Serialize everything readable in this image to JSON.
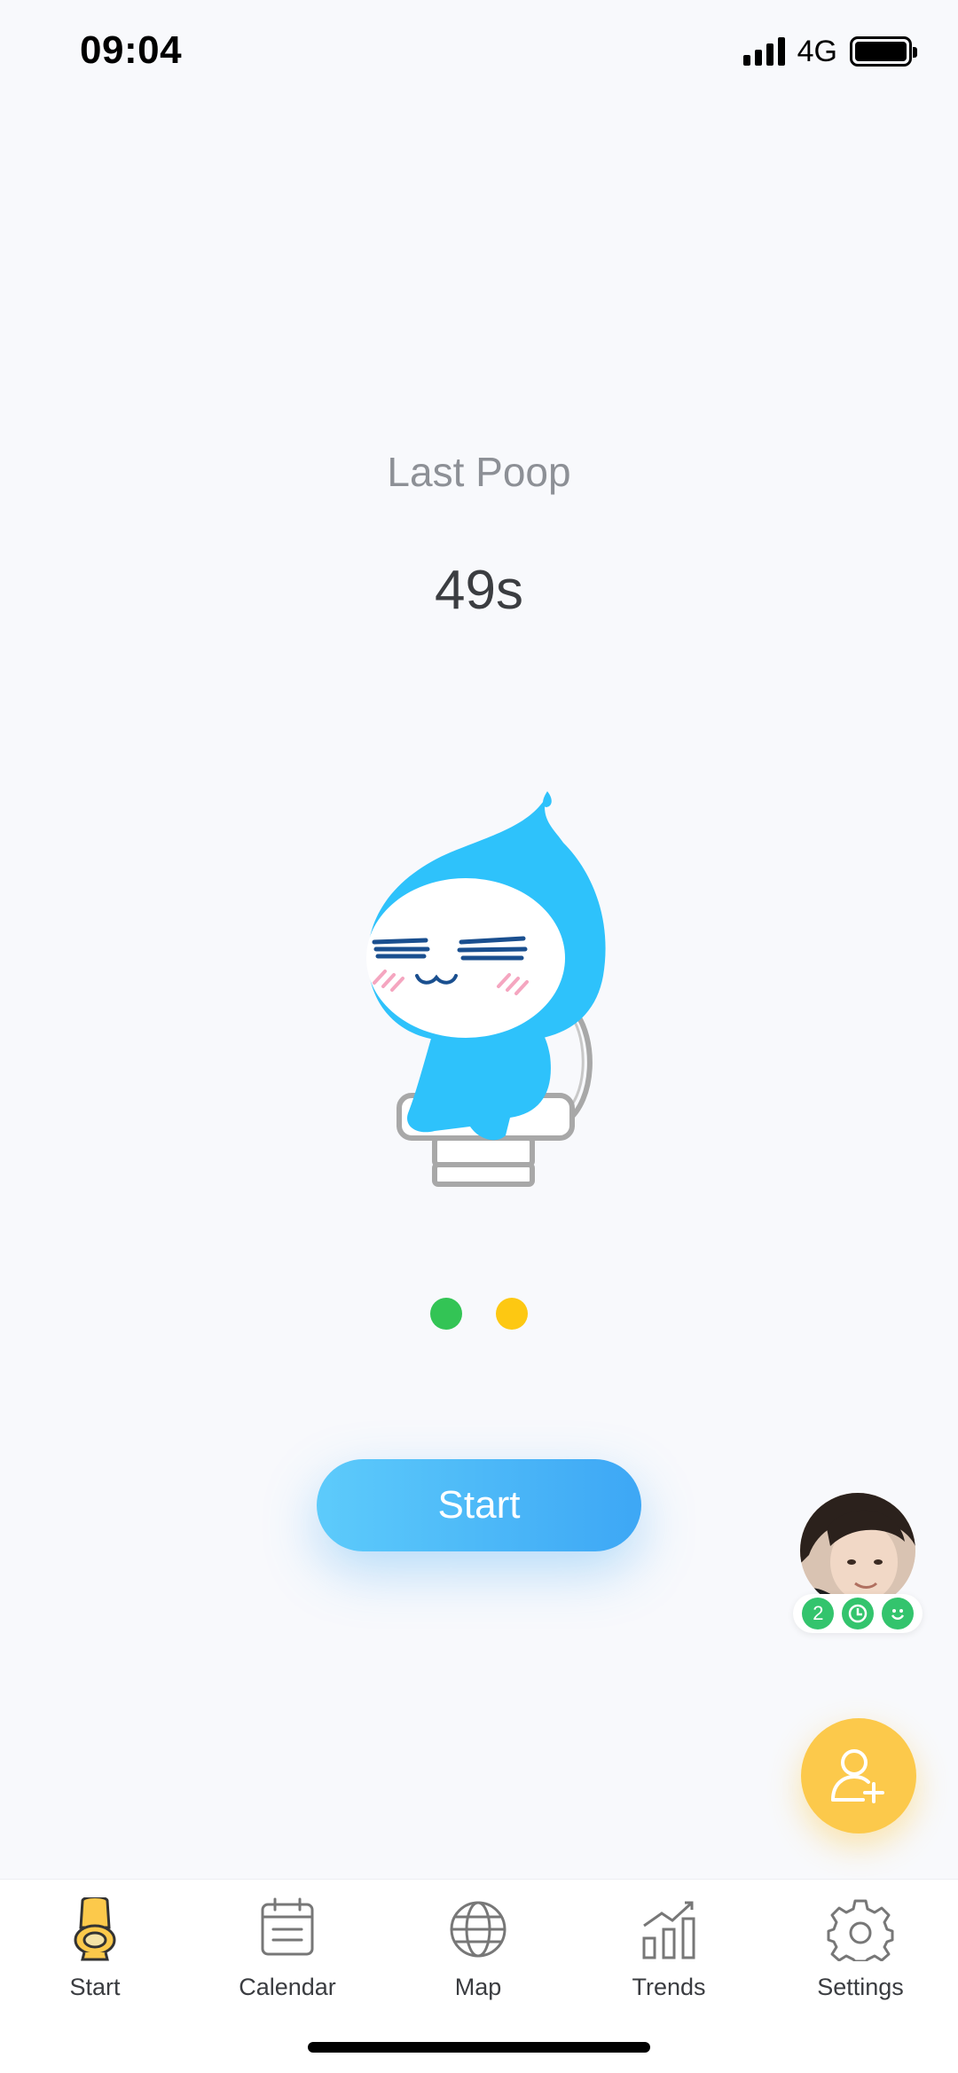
{
  "status_bar": {
    "time": "09:04",
    "network": "4G",
    "battery_level": 1.0
  },
  "main": {
    "last_title": "Last Poop",
    "last_value": "49s",
    "mascot_icon": "poop-mascot-on-toilet",
    "indicator_dots": [
      {
        "color": "#33c455"
      },
      {
        "color": "#fdc812"
      }
    ],
    "start_button_label": "Start"
  },
  "friend_widget": {
    "avatar_icon": "friend-avatar",
    "badges": [
      {
        "text": "2",
        "icon": "count-badge"
      },
      {
        "text": "",
        "icon": "clock-icon"
      },
      {
        "text": "",
        "icon": "smile-icon"
      }
    ]
  },
  "add_friend_icon": "add-user-icon",
  "tabs": [
    {
      "label": "Start",
      "icon": "toilet-icon",
      "active": true
    },
    {
      "label": "Calendar",
      "icon": "calendar-icon",
      "active": false
    },
    {
      "label": "Map",
      "icon": "globe-icon",
      "active": false
    },
    {
      "label": "Trends",
      "icon": "trends-chart-icon",
      "active": false
    },
    {
      "label": "Settings",
      "icon": "gear-icon",
      "active": false
    }
  ],
  "colors": {
    "accent_blue": "#3da7f5",
    "accent_yellow": "#fcc94b",
    "badge_green": "#33c46d"
  }
}
